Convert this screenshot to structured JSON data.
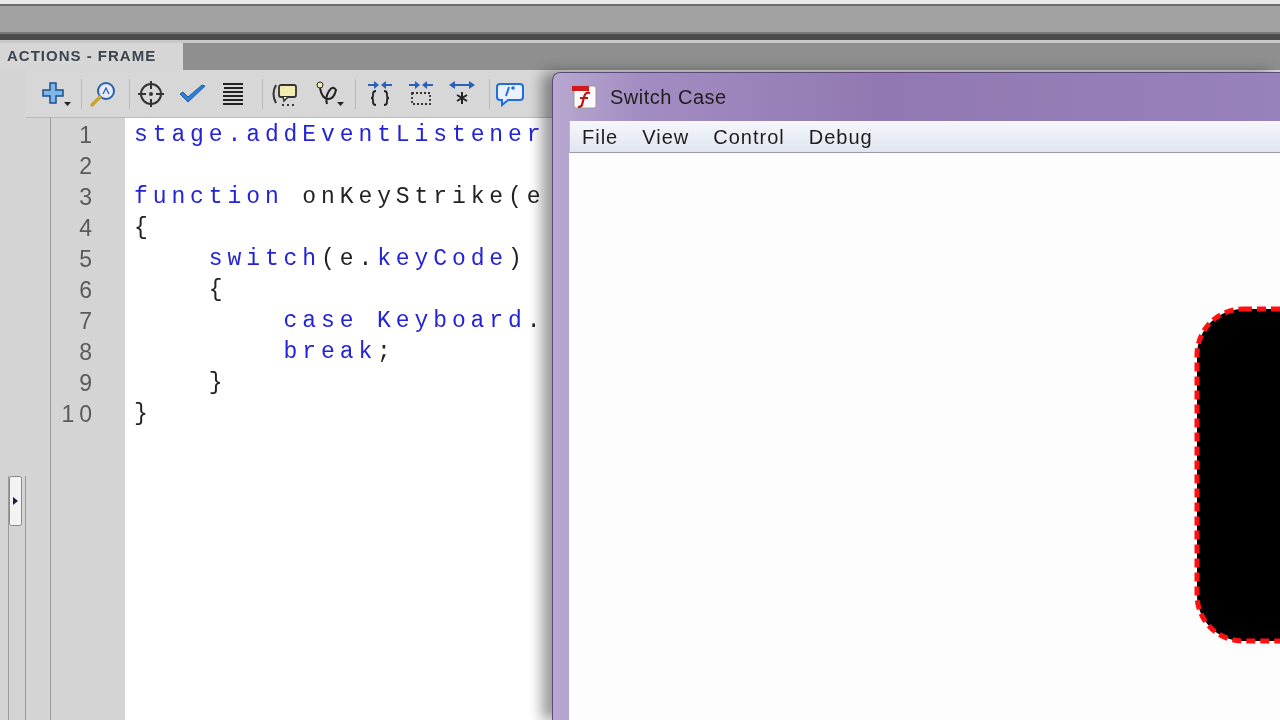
{
  "panel": {
    "tabs": [
      {
        "label": "ACTIONS - FRAME",
        "selected": true
      }
    ],
    "code": [
      {
        "number": "1",
        "tokens": [
          {
            "text": "stage.addEventListener",
            "kind": "keyword"
          }
        ]
      },
      {
        "number": "2"
      },
      {
        "number": "3",
        "tokens": [
          {
            "text": "function",
            "kind": "keyword"
          },
          {
            "text": " onKeyStrike(e",
            "kind": "plain"
          }
        ]
      },
      {
        "number": "4",
        "tokens": [
          {
            "text": "{",
            "kind": "plain"
          }
        ],
        "children": [
          {
            "number": "5",
            "tokens": [
              {
                "text": "switch",
                "kind": "keyword"
              },
              {
                "text": "(e.",
                "kind": "plain"
              },
              {
                "text": "keyCode",
                "kind": "keyword"
              },
              {
                "text": ")",
                "kind": "plain"
              }
            ]
          },
          {
            "number": "6",
            "tokens": [
              {
                "text": "{",
                "kind": "plain"
              }
            ],
            "children": [
              {
                "number": "7",
                "tokens": [
                  {
                    "text": "case Keyboard",
                    "kind": "keyword"
                  },
                  {
                    "text": ".",
                    "kind": "plain"
                  }
                ]
              },
              {
                "number": "8",
                "tokens": [
                  {
                    "text": "break",
                    "kind": "keyword"
                  },
                  {
                    "text": ";",
                    "kind": "plain"
                  }
                ]
              }
            ]
          },
          {
            "number": "9",
            "tokens": [
              {
                "text": "}",
                "kind": "plain"
              }
            ]
          }
        ]
      },
      {
        "number": "10",
        "tokens": [
          {
            "text": "}",
            "kind": "plain"
          }
        ]
      }
    ]
  },
  "window": {
    "title": "Switch Case",
    "menu": [
      {
        "label": "File"
      },
      {
        "label": "View"
      },
      {
        "label": "Control"
      },
      {
        "label": "Debug"
      }
    ]
  }
}
